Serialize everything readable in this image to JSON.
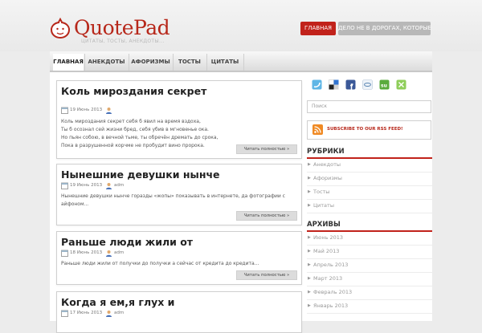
{
  "header": {
    "site_title": "QuotePad",
    "tagline": "ЦИТАТЫ, ТОСТЫ, АНЕКДОТЫ...",
    "buttons": [
      "ГЛАВНАЯ",
      "ДЕЛО НЕ В ДОРОГАХ, КОТОРЫЕ"
    ]
  },
  "nav": {
    "items": [
      "ГЛАВНАЯ",
      "АНЕКДОТЫ",
      "АФОРИЗМЫ",
      "ТОСТЫ",
      "ЦИТАТЫ"
    ]
  },
  "posts": [
    {
      "title": "Коль мироздания секрет",
      "date": "19 Июнь 2013",
      "author": "",
      "lines": [
        "Коль мироздания секрет себя б явил на время вздоха,",
        "Ты б осознал сей жизни бред, себя убив в мгновенье ока.",
        "Но пьян собою, в вечной тьме, ты обречён дремать до срока,",
        "Пока в разрушенной корчме не пробудит вино пророка."
      ],
      "read_more": "Читать полностью »"
    },
    {
      "title": "Нынешние девушки нынче",
      "date": "19 Июнь 2013",
      "author": "adm",
      "lines": [
        "Нынешние девушки нынче горазды «жопы» показывать в интернете, да фотографии с",
        "айфоном..."
      ],
      "read_more": "Читать полностью »"
    },
    {
      "title": "Раньше люди жили от",
      "date": "18 Июнь 2013",
      "author": "adm",
      "lines": [
        "Раньше люди жили от получки до получки а сейчас от кредита до кредита..."
      ],
      "read_more": "Читать полностью »"
    },
    {
      "title": "Когда я ем,я глух и",
      "date": "17 Июнь 2013",
      "author": "adm",
      "lines": [],
      "read_more": ""
    }
  ],
  "sidebar": {
    "social_icons": [
      "twitter-icon",
      "delicious-icon",
      "facebook-icon",
      "digg-icon",
      "stumbleupon-icon",
      "technorati-icon"
    ],
    "search_placeholder": "Поиск",
    "rss_label": "SUBSCRIBE TO OUR RSS FEED!",
    "categories_title": "РУБРИКИ",
    "categories": [
      "Анекдоты",
      "Афоризмы",
      "Тосты",
      "Цитаты"
    ],
    "archives_title": "АРХИВЫ",
    "archives": [
      "Июнь 2013",
      "Май 2013",
      "Апрель 2013",
      "Март 2013",
      "Февраль 2013",
      "Январь 2013"
    ]
  },
  "colors": {
    "brand_red": "#b7271a",
    "button_red": "#c1221b",
    "button_gray": "#b8b8b8",
    "background": "#ececec"
  }
}
